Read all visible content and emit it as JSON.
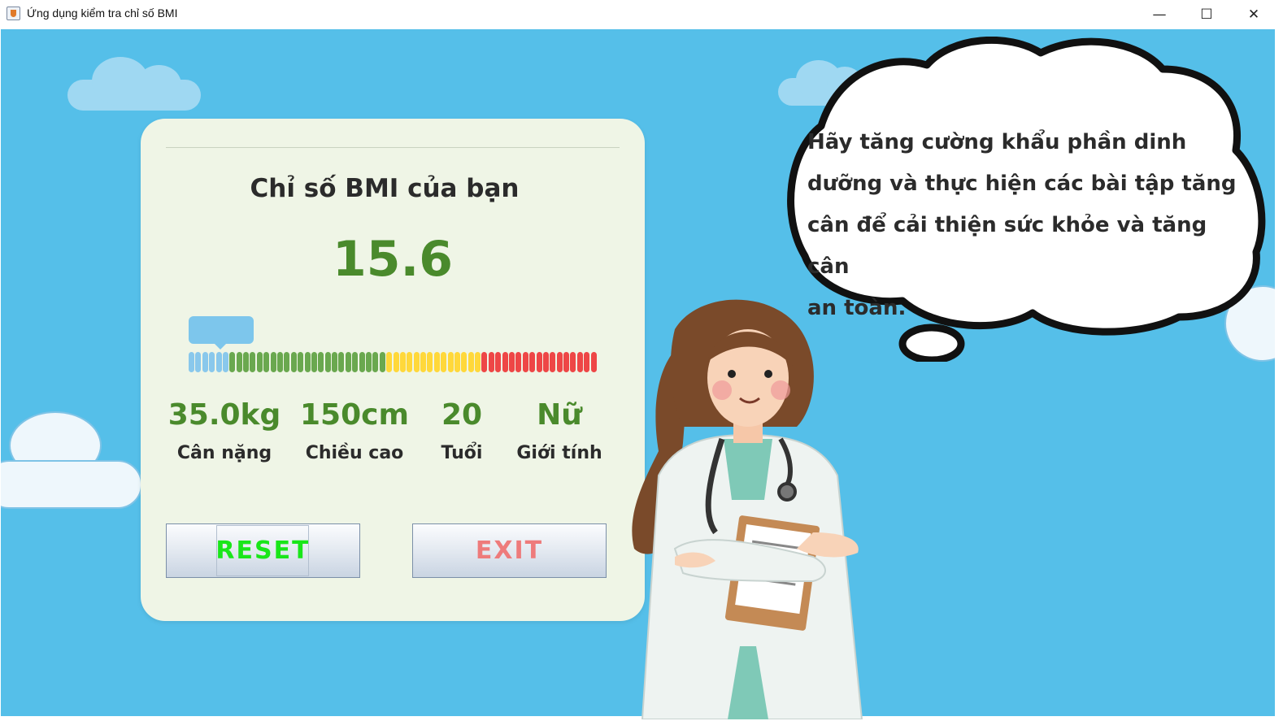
{
  "window": {
    "title": "Ứng dụng kiểm tra chỉ số BMI",
    "minimize": "—",
    "maximize": "☐",
    "close": "✕"
  },
  "card": {
    "title": "Chỉ số BMI của bạn",
    "bmi_value": "15.6",
    "scale": {
      "segment_counts": {
        "blue": 6,
        "green": 23,
        "yellow": 14,
        "red": 17
      },
      "colors": {
        "blue": "#89c8ec",
        "green": "#6aa84f",
        "yellow": "#ffd83a",
        "red": "#ee4646"
      },
      "indicator_segment_index": 2
    },
    "stats": {
      "weight": {
        "value": "35.0kg",
        "label": "Cân nặng"
      },
      "height": {
        "value": "150cm",
        "label": "Chiều cao"
      },
      "age": {
        "value": "20",
        "label": "Tuổi"
      },
      "gender": {
        "value": "Nữ",
        "label": "Giới tính"
      }
    },
    "buttons": {
      "reset": "RESET",
      "exit": "EXIT"
    }
  },
  "advice": {
    "lines": [
      "Hãy tăng cường khẩu phần dinh",
      "dưỡng và thực hiện các bài tập tăng",
      "cân để cải thiện sức khỏe và tăng cân",
      "an toàn."
    ]
  },
  "colors": {
    "background": "#55bfe9",
    "card": "#eff5e6",
    "accent_green": "#4a8a2c",
    "reset_text": "#19e619",
    "exit_text": "#ee7b7b"
  },
  "illustration": {
    "icon": "doctor-illustration"
  }
}
